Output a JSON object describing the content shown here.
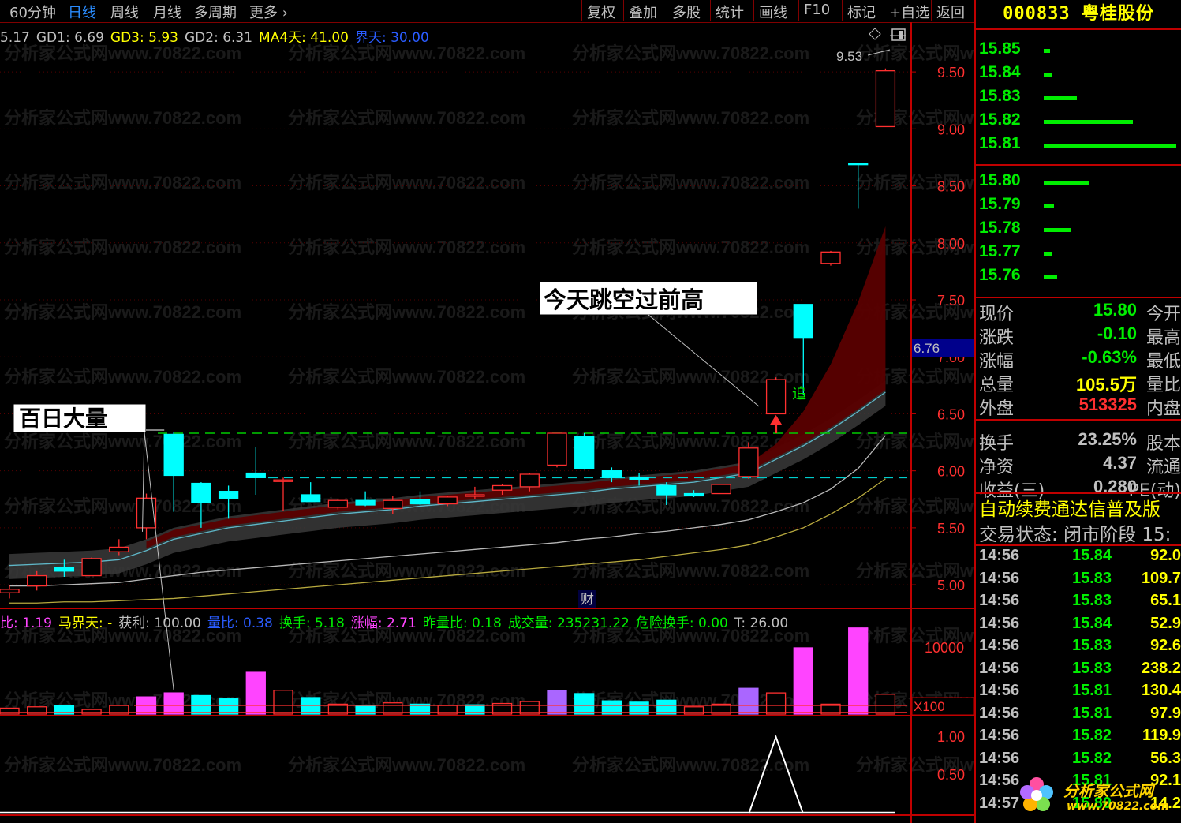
{
  "toolbar": {
    "period_60m": "60分钟",
    "period_day": "日线",
    "period_week": "周线",
    "period_month": "月线",
    "multi_period": "多周期",
    "more": "更多",
    "btn_restore": "复权",
    "btn_overlay": "叠加",
    "btn_multi_stock": "多股",
    "btn_stats": "统计",
    "btn_draw": "画线",
    "btn_f10": "F10",
    "btn_mark": "标记",
    "btn_add_fav": "+自选",
    "btn_back": "返回"
  },
  "main_indicators": [
    {
      "text": "5.17",
      "color": "#c0c0c0"
    },
    {
      "text": "GD1: 6.69",
      "color": "#c0c0c0"
    },
    {
      "text": "GD3: 5.93",
      "color": "#ffff00"
    },
    {
      "text": "GD2: 6.31",
      "color": "#c0c0c0"
    },
    {
      "text": "MA4天: 41.00",
      "color": "#ffff00"
    },
    {
      "text": "界天: 30.00",
      "color": "#2a5cff"
    }
  ],
  "volume_indicators": [
    {
      "text": "比: 1.19",
      "color": "#ff44ff"
    },
    {
      "text": "马界天: -",
      "color": "#ffff00"
    },
    {
      "text": "获利: 100.00",
      "color": "#c0c0c0"
    },
    {
      "text": "量比: 0.38",
      "color": "#2a5cff"
    },
    {
      "text": "换手: 5.18",
      "color": "#00ee00"
    },
    {
      "text": "涨幅: 2.71",
      "color": "#ff44ff"
    },
    {
      "text": "昨量比: 0.18",
      "color": "#00ee00"
    },
    {
      "text": "成交量: 235231.22",
      "color": "#00ee00"
    },
    {
      "text": "危险换手: 0.00",
      "color": "#00ee00"
    },
    {
      "text": "T: 26.00",
      "color": "#c0c0c0"
    }
  ],
  "annotations": {
    "left_box": "百日大量",
    "right_box": "今天跳空过前高",
    "chase_label": "追",
    "cai_label": "财",
    "high_label": "9.53"
  },
  "watermark": "分析家公式网www.70822.com",
  "axis": {
    "current_price_tag": "6.76",
    "vol_scale_label": "X100"
  },
  "chart_data": [
    {
      "type": "candlestick",
      "title": "",
      "ylim": [
        4.8,
        9.75
      ],
      "yticks": [
        "9.50",
        "9.00",
        "8.50",
        "8.00",
        "7.50",
        "7.00",
        "6.50",
        "6.00",
        "5.50",
        "5.00"
      ],
      "ytick_values": [
        9.5,
        9.0,
        8.5,
        8.0,
        7.5,
        7.0,
        6.5,
        6.0,
        5.5,
        5.0
      ],
      "candles": [
        {
          "o": 4.93,
          "h": 5.0,
          "l": 4.88,
          "c": 4.96,
          "up": true
        },
        {
          "o": 4.99,
          "h": 5.12,
          "l": 4.95,
          "c": 5.08,
          "up": true
        },
        {
          "o": 5.12,
          "h": 5.22,
          "l": 5.07,
          "c": 5.15,
          "up": false
        },
        {
          "o": 5.08,
          "h": 5.24,
          "l": 5.08,
          "c": 5.23,
          "up": true
        },
        {
          "o": 5.29,
          "h": 5.4,
          "l": 5.26,
          "c": 5.33,
          "up": true
        },
        {
          "o": 5.5,
          "h": 5.8,
          "l": 5.4,
          "c": 5.76,
          "up": true
        },
        {
          "o": 6.32,
          "h": 6.34,
          "l": 5.64,
          "c": 5.96,
          "up": false
        },
        {
          "o": 5.89,
          "h": 5.9,
          "l": 5.5,
          "c": 5.72,
          "up": false
        },
        {
          "o": 5.82,
          "h": 5.87,
          "l": 5.58,
          "c": 5.76,
          "up": false
        },
        {
          "o": 5.98,
          "h": 6.21,
          "l": 5.79,
          "c": 5.94,
          "up": false
        },
        {
          "o": 5.91,
          "h": 5.94,
          "l": 5.65,
          "c": 5.92,
          "up": true
        },
        {
          "o": 5.79,
          "h": 5.9,
          "l": 5.74,
          "c": 5.73,
          "up": false
        },
        {
          "o": 5.68,
          "h": 5.75,
          "l": 5.66,
          "c": 5.74,
          "up": true
        },
        {
          "o": 5.74,
          "h": 5.82,
          "l": 5.69,
          "c": 5.7,
          "up": false
        },
        {
          "o": 5.67,
          "h": 5.78,
          "l": 5.62,
          "c": 5.74,
          "up": true
        },
        {
          "o": 5.75,
          "h": 5.82,
          "l": 5.7,
          "c": 5.71,
          "up": false
        },
        {
          "o": 5.71,
          "h": 5.78,
          "l": 5.69,
          "c": 5.77,
          "up": true
        },
        {
          "o": 5.79,
          "h": 5.86,
          "l": 5.75,
          "c": 5.78,
          "up": true
        },
        {
          "o": 5.83,
          "h": 5.88,
          "l": 5.79,
          "c": 5.87,
          "up": true
        },
        {
          "o": 5.86,
          "h": 5.98,
          "l": 5.82,
          "c": 5.97,
          "up": true
        },
        {
          "o": 6.05,
          "h": 6.33,
          "l": 6.03,
          "c": 6.33,
          "up": true
        },
        {
          "o": 6.3,
          "h": 6.33,
          "l": 6.01,
          "c": 6.02,
          "up": false
        },
        {
          "o": 6.0,
          "h": 6.03,
          "l": 5.9,
          "c": 5.94,
          "up": false
        },
        {
          "o": 5.94,
          "h": 5.98,
          "l": 5.87,
          "c": 5.93,
          "up": false
        },
        {
          "o": 5.87,
          "h": 5.9,
          "l": 5.7,
          "c": 5.79,
          "up": false
        },
        {
          "o": 5.8,
          "h": 5.83,
          "l": 5.77,
          "c": 5.78,
          "up": false
        },
        {
          "o": 5.8,
          "h": 5.88,
          "l": 5.8,
          "c": 5.88,
          "up": true
        },
        {
          "o": 5.95,
          "h": 6.25,
          "l": 5.93,
          "c": 6.2,
          "up": true
        },
        {
          "o": 6.5,
          "h": 6.82,
          "l": 6.5,
          "c": 6.8,
          "up": true
        },
        {
          "o": 7.46,
          "h": 7.46,
          "l": 6.67,
          "c": 7.17,
          "up": false
        },
        {
          "o": 7.82,
          "h": 7.93,
          "l": 7.8,
          "c": 7.92,
          "up": true
        },
        {
          "o": 8.7,
          "h": 8.7,
          "l": 8.3,
          "c": 8.7,
          "up": false
        },
        {
          "o": 9.02,
          "h": 9.53,
          "l": 9.02,
          "c": 9.51,
          "up": true
        }
      ],
      "resistance_lines": [
        6.33,
        5.94
      ],
      "ma_lines": [
        {
          "name": "GD1",
          "color": "#5fb7c8",
          "values": [
            5.17,
            5.18,
            5.19,
            5.2,
            5.22,
            5.3,
            5.4,
            5.45,
            5.5,
            5.53,
            5.56,
            5.59,
            5.62,
            5.64,
            5.66,
            5.69,
            5.71,
            5.73,
            5.75,
            5.77,
            5.79,
            5.81,
            5.84,
            5.86,
            5.88,
            5.9,
            5.94,
            5.98,
            6.1,
            6.22,
            6.36,
            6.52,
            6.69
          ]
        },
        {
          "name": "GD2",
          "color": "#b8b8b8",
          "values": [
            4.99,
            4.99,
            5.0,
            5.01,
            5.02,
            5.05,
            5.08,
            5.11,
            5.13,
            5.15,
            5.17,
            5.19,
            5.21,
            5.23,
            5.25,
            5.27,
            5.29,
            5.31,
            5.33,
            5.35,
            5.37,
            5.4,
            5.42,
            5.45,
            5.47,
            5.5,
            5.53,
            5.57,
            5.64,
            5.72,
            5.84,
            6.02,
            6.31
          ]
        },
        {
          "name": "GD3",
          "color": "#b7a93e",
          "values": [
            4.84,
            4.84,
            4.85,
            4.85,
            4.86,
            4.87,
            4.88,
            4.9,
            4.92,
            4.94,
            4.96,
            4.98,
            5.0,
            5.02,
            5.04,
            5.06,
            5.08,
            5.1,
            5.12,
            5.14,
            5.16,
            5.18,
            5.2,
            5.22,
            5.25,
            5.28,
            5.31,
            5.35,
            5.42,
            5.5,
            5.62,
            5.76,
            5.93
          ]
        }
      ],
      "volume": {
        "ylim": [
          0,
          12500
        ],
        "ytick_labels": [
          "10000"
        ],
        "ytick_values": [
          10000
        ],
        "values": [
          900,
          1100,
          1300,
          700,
          1300,
          2600,
          3200,
          2800,
          2300,
          6300,
          3600,
          2500,
          1500,
          1300,
          1700,
          1500,
          1300,
          1400,
          1600,
          1900,
          3600,
          3100,
          2000,
          1800,
          2100,
          1100,
          1500,
          3900,
          3200,
          10000,
          1500,
          13000,
          3000
        ],
        "bar_colors": [
          "#ff3030",
          "#ff3030",
          "#00ffff",
          "#ff3030",
          "#ff3030",
          "#ff44ff",
          "#ff44ff",
          "#00ffff",
          "#00ffff",
          "#ff44ff",
          "#ff3030",
          "#00ffff",
          "#ff3030",
          "#00ffff",
          "#ff3030",
          "#00ffff",
          "#ff3030",
          "#00ffff",
          "#ff3030",
          "#ff3030",
          "#aa66ff",
          "#00ffff",
          "#00ffff",
          "#00ffff",
          "#00ffff",
          "#ff3030",
          "#ff3030",
          "#aa66ff",
          "#ff3030",
          "#ff44ff",
          "#ff3030",
          "#ff44ff",
          "#ff3030"
        ]
      },
      "signal": {
        "ylim": [
          0,
          1.2
        ],
        "ytick_labels": [
          "1.00",
          "0.50"
        ],
        "ytick_values": [
          1.0,
          0.5
        ],
        "values": [
          0,
          0,
          0,
          0,
          0,
          0,
          0,
          0,
          0,
          0,
          0,
          0,
          0,
          0,
          0,
          0,
          0,
          0,
          0,
          0,
          0,
          0,
          0,
          0,
          0,
          0,
          0,
          0,
          1.0,
          0,
          0,
          0,
          0
        ]
      }
    }
  ],
  "panel": {
    "code": "000833",
    "name": "粤桂股份",
    "ask_prices": [
      "15.85",
      "15.84",
      "15.83",
      "15.82",
      "15.81"
    ],
    "ask_bars": [
      0.05,
      0.06,
      0.25,
      0.67,
      1.0
    ],
    "bid_prices": [
      "15.80",
      "15.79",
      "15.78",
      "15.77",
      "15.76"
    ],
    "bid_bars": [
      0.34,
      0.08,
      0.21,
      0.06,
      0.1
    ],
    "info": [
      {
        "label": "现价",
        "value": "15.80",
        "value_color": "#00ee00",
        "label2": "今开"
      },
      {
        "label": "涨跌",
        "value": "-0.10",
        "value_color": "#00ee00",
        "label2": "最高"
      },
      {
        "label": "涨幅",
        "value": "-0.63%",
        "value_color": "#00ee00",
        "label2": "最低"
      },
      {
        "label": "总量",
        "value": "105.5万",
        "value_color": "#ffff00",
        "label2": "量比"
      },
      {
        "label": "外盘",
        "value": "513325",
        "value_color": "#ff3030",
        "label2": "内盘"
      },
      {
        "label": "换手",
        "value": "23.25%",
        "value_color": "#c0c0c0",
        "label2": "股本"
      },
      {
        "label": "净资",
        "value": "4.37",
        "value_color": "#c0c0c0",
        "label2": "流通"
      },
      {
        "label": "收益(三)",
        "value": "0.280",
        "value_color": "#c0c0c0",
        "label2": "PE(动)"
      }
    ],
    "notice": "自动续费通达信普及版",
    "status": "交易状态: 闭市阶段 15:",
    "ticks": [
      {
        "time": "14:56",
        "price": "15.84",
        "vol": "92.0"
      },
      {
        "time": "14:56",
        "price": "15.83",
        "vol": "109.7"
      },
      {
        "time": "14:56",
        "price": "15.83",
        "vol": "65.1"
      },
      {
        "time": "14:56",
        "price": "15.84",
        "vol": "52.9"
      },
      {
        "time": "14:56",
        "price": "15.83",
        "vol": "92.6"
      },
      {
        "time": "14:56",
        "price": "15.83",
        "vol": "238.2"
      },
      {
        "time": "14:56",
        "price": "15.81",
        "vol": "130.4"
      },
      {
        "time": "14:56",
        "price": "15.81",
        "vol": "97.9"
      },
      {
        "time": "14:56",
        "price": "15.82",
        "vol": "119.9"
      },
      {
        "time": "14:56",
        "price": "15.82",
        "vol": "56.3"
      },
      {
        "time": "14:56",
        "price": "15.81",
        "vol": "92.1"
      },
      {
        "time": "14:57",
        "price": "15.80",
        "vol": "14.2"
      }
    ]
  },
  "logo": {
    "text": "分析家公式网",
    "url": "www.70822.com"
  }
}
